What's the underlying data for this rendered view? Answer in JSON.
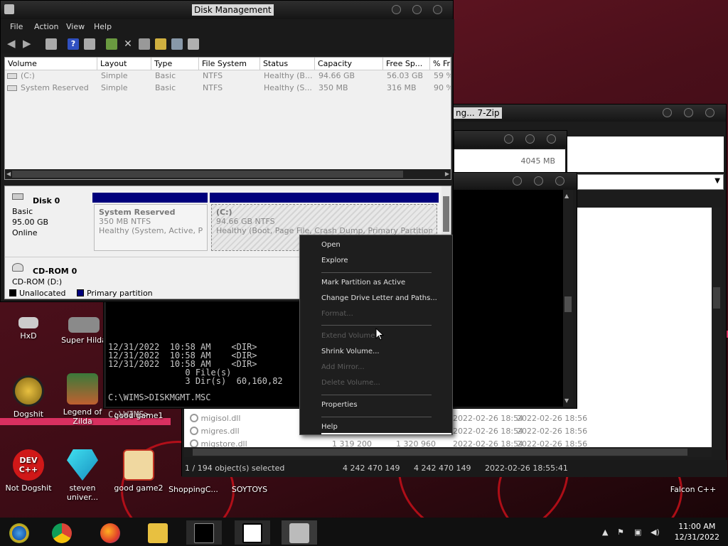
{
  "desktop": {
    "icons": [
      {
        "label": "HxD"
      },
      {
        "label": "Super Hilda"
      },
      {
        "label": "Dogshit"
      },
      {
        "label": "Legend of Zilda"
      },
      {
        "label": "good game1"
      },
      {
        "label": "Not Dogshit"
      },
      {
        "label": "steven univer..."
      },
      {
        "label": "good game2"
      },
      {
        "label": "ShoppingC..."
      },
      {
        "label": "SOYTOYS"
      },
      {
        "label": "Falcon C++"
      }
    ],
    "icon_badges": {
      "devcpp": "DEV\nC++"
    }
  },
  "disk_management": {
    "title": "Disk Management",
    "menu": [
      "File",
      "Action",
      "View",
      "Help"
    ],
    "columns": [
      "Volume",
      "Layout",
      "Type",
      "File System",
      "Status",
      "Capacity",
      "Free Sp...",
      "% Fre"
    ],
    "volumes": [
      [
        "(C:)",
        "Simple",
        "Basic",
        "NTFS",
        "Healthy (B...",
        "94.66 GB",
        "56.03 GB",
        "59 %"
      ],
      [
        "System Reserved",
        "Simple",
        "Basic",
        "NTFS",
        "Healthy (S...",
        "350 MB",
        "316 MB",
        "90 %"
      ]
    ],
    "disk0": {
      "name": "Disk 0",
      "type": "Basic",
      "size": "95.00 GB",
      "state": "Online",
      "partitions": [
        {
          "name": "System Reserved",
          "size": "350 MB NTFS",
          "status": "Healthy (System, Active, Prin"
        },
        {
          "name": "(C:)",
          "size": "94.66 GB NTFS",
          "status": "Healthy (Boot, Page File, Crash Dump, Primary Partition)"
        }
      ]
    },
    "cdrom": {
      "name": "CD-ROM 0",
      "drive": "CD-ROM (D:)"
    },
    "legend": {
      "unallocated": "Unallocated",
      "primary": "Primary partition"
    }
  },
  "context_menu": {
    "items": [
      {
        "label": "Open",
        "enabled": true
      },
      {
        "label": "Explore",
        "enabled": true
      },
      {
        "label": "Mark Partition as Active",
        "enabled": true
      },
      {
        "label": "Change Drive Letter and Paths...",
        "enabled": true
      },
      {
        "label": "Format...",
        "enabled": false
      },
      {
        "label": "Extend Volume...",
        "enabled": false
      },
      {
        "label": "Shrink Volume...",
        "enabled": true
      },
      {
        "label": "Add Mirror...",
        "enabled": false
      },
      {
        "label": "Delete Volume...",
        "enabled": false
      },
      {
        "label": "Properties",
        "enabled": true
      },
      {
        "label": "Help",
        "enabled": true
      }
    ]
  },
  "cmd": {
    "lines": [
      "12/31/2022  10:58 AM    <DIR>",
      "12/31/2022  10:58 AM    <DIR>",
      "12/31/2022  10:58 AM    <DIR>",
      "               0 File(s)",
      "               3 Dir(s)  60,160,82",
      "",
      "C:\\WIMS>DISKMGMT.MSC",
      "",
      "C:\\WIMS>"
    ]
  },
  "sevenzip": {
    "title": "ng... 7-Zip",
    "inner_size": "4045 MB",
    "rows": [
      {
        "name": "migisol.dll",
        "modified": "2022-02-26 18:54",
        "created": "2022-02-26 18:56"
      },
      {
        "name": "migres.dll",
        "modified": "2022-02-26 18:54",
        "created": "2022-02-26 18:56"
      },
      {
        "name": "migstore.dll",
        "size": "1 319 200",
        "packed": "1 320 960",
        "modified": "2022-02-26 18:54",
        "created": "2022-02-26 18:56"
      }
    ],
    "status": {
      "selection": "1 / 194 object(s) selected",
      "size": "4 242 470 149",
      "packed": "4 242 470 149",
      "date": "2022-02-26 18:55:41"
    }
  },
  "taskbar": {
    "time": "11:00 AM",
    "date": "12/31/2022"
  },
  "colors": {
    "primary_partition": "#00007c",
    "desktop_bg": "#5a1420"
  }
}
